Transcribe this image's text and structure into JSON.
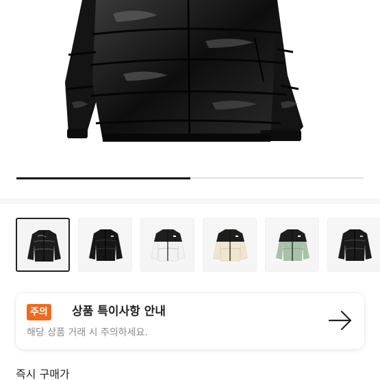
{
  "product": {
    "main_image": "black-puffer-jacket-photo",
    "carousel_progress": 0.5
  },
  "thumbnails": [
    {
      "name": "thumb-black-glossy",
      "color": "#1c1c1c",
      "selected": true
    },
    {
      "name": "thumb-black-matte",
      "color": "#161616",
      "selected": false
    },
    {
      "name": "thumb-white-black",
      "color": "#f2f2f2",
      "selected": false
    },
    {
      "name": "thumb-cream-black",
      "color": "#eee6cf",
      "selected": false
    },
    {
      "name": "thumb-sage-black",
      "color": "#a9c1a9",
      "selected": false
    },
    {
      "name": "thumb-black-partial",
      "color": "#1a1a1a",
      "selected": false
    }
  ],
  "notice": {
    "badge": "주의",
    "title": "상품 특이사항 안내",
    "subtitle": "해당 상품 거래 시 주의하세요.",
    "arrow_icon": "arrow-right-icon"
  },
  "section": {
    "title": "즉시 구매가"
  },
  "colors": {
    "badge_bg": "#ef6a1a",
    "text_primary": "#222222",
    "text_secondary": "#8a8a8a"
  }
}
